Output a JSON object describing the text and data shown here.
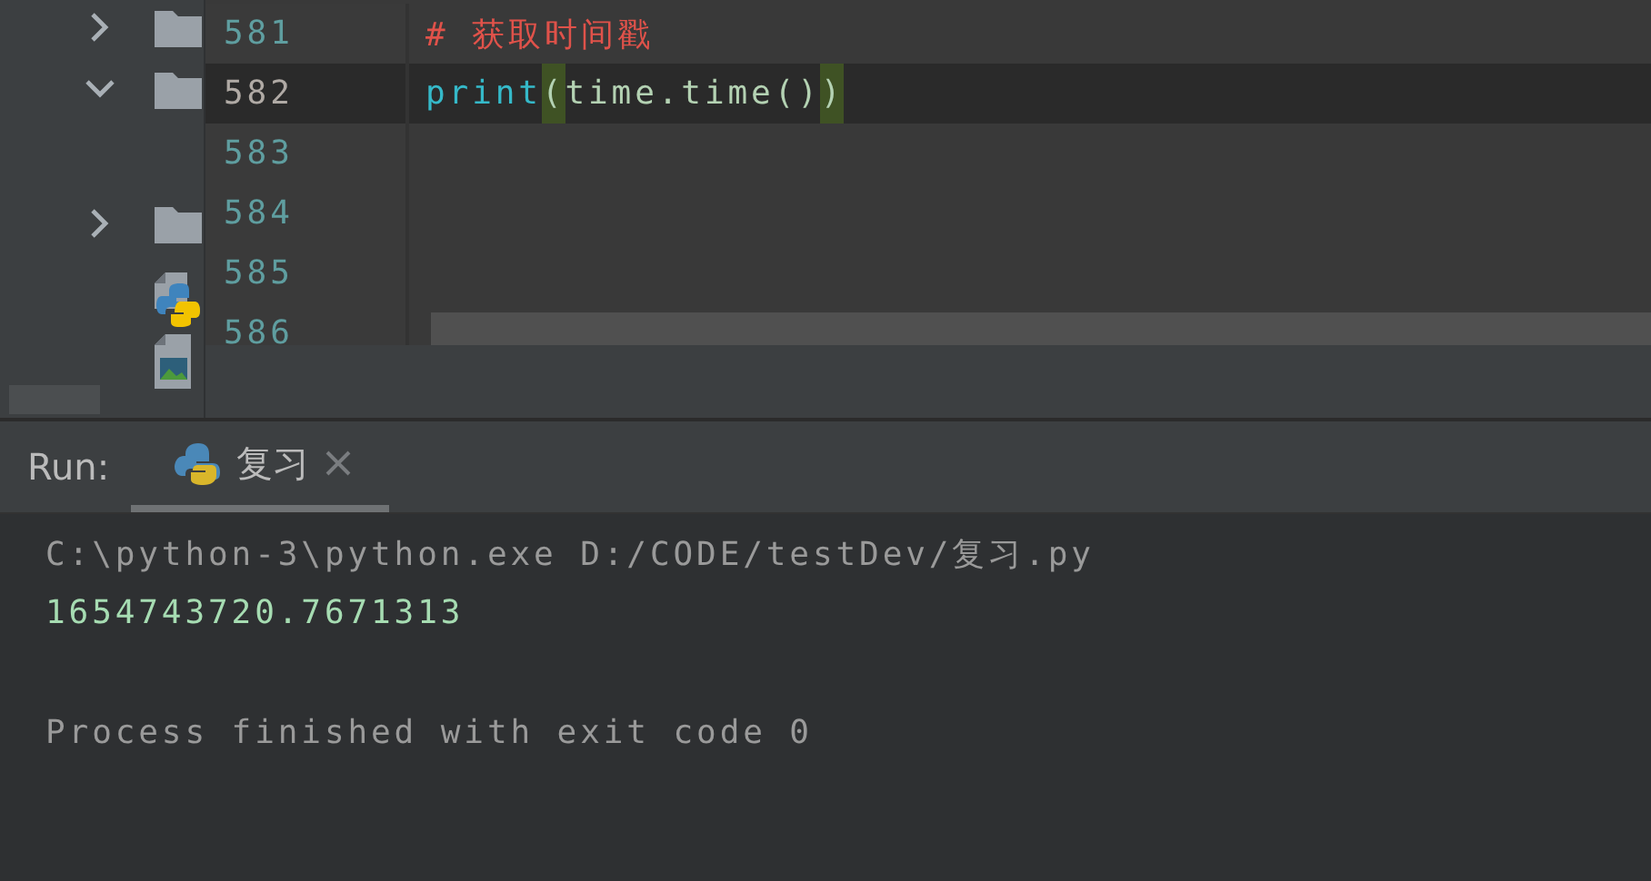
{
  "project_tree": [
    {
      "kind": "folder",
      "expanded": false
    },
    {
      "kind": "folder",
      "expanded": true
    },
    {
      "kind": "folder",
      "expanded": false
    },
    {
      "kind": "python-file"
    },
    {
      "kind": "image-file"
    }
  ],
  "editor": {
    "lines": [
      {
        "number": "581",
        "current": false,
        "tokens": [
          {
            "text": "# 获取时间戳",
            "kind": "comment"
          }
        ]
      },
      {
        "number": "582",
        "current": true,
        "tokens": [
          {
            "text": "print",
            "kind": "builtin"
          },
          {
            "text": "(",
            "kind": "paren",
            "matched": true
          },
          {
            "text": "time.time()",
            "kind": "plain"
          },
          {
            "text": ")",
            "kind": "paren",
            "matched": true
          }
        ]
      },
      {
        "number": "583",
        "current": false
      },
      {
        "number": "584",
        "current": false
      },
      {
        "number": "585",
        "current": false
      },
      {
        "number": "586",
        "current": false
      }
    ]
  },
  "run_panel": {
    "label": "Run:",
    "tabs": [
      {
        "label": "复习",
        "selected": true
      }
    ],
    "output": [
      {
        "text": "C:\\python-3\\python.exe D:/CODE/testDev/复习.py",
        "kind": "command"
      },
      {
        "text": "1654743720.7671313",
        "kind": "result"
      },
      {
        "text": "Process finished with exit code 0",
        "kind": "info"
      }
    ]
  }
}
